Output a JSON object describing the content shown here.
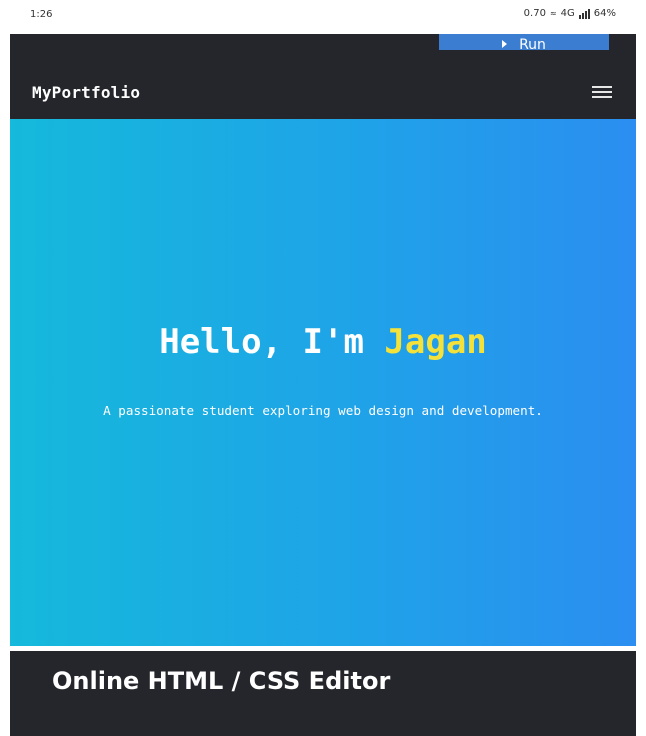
{
  "status_bar": {
    "time": "1:26",
    "speed": "0.70",
    "wifi": "≈",
    "network": "4G",
    "battery": "64%"
  },
  "toolbar": {
    "run_label": "Run",
    "run_icon": "play-icon"
  },
  "navbar": {
    "brand": "MyPortfolio",
    "menu_icon": "hamburger-menu-icon"
  },
  "hero": {
    "greeting": "Hello, I'm ",
    "name": "Jagan",
    "subtitle": "A passionate student exploring web design and development.",
    "gradient_start": "#15b9db",
    "gradient_end": "#2b8ef0",
    "accent_color": "#f4e23a"
  },
  "editor_section": {
    "title": "Online HTML / CSS Editor"
  },
  "colors": {
    "dark_background": "#24262b",
    "run_button": "#3a7dd1"
  }
}
